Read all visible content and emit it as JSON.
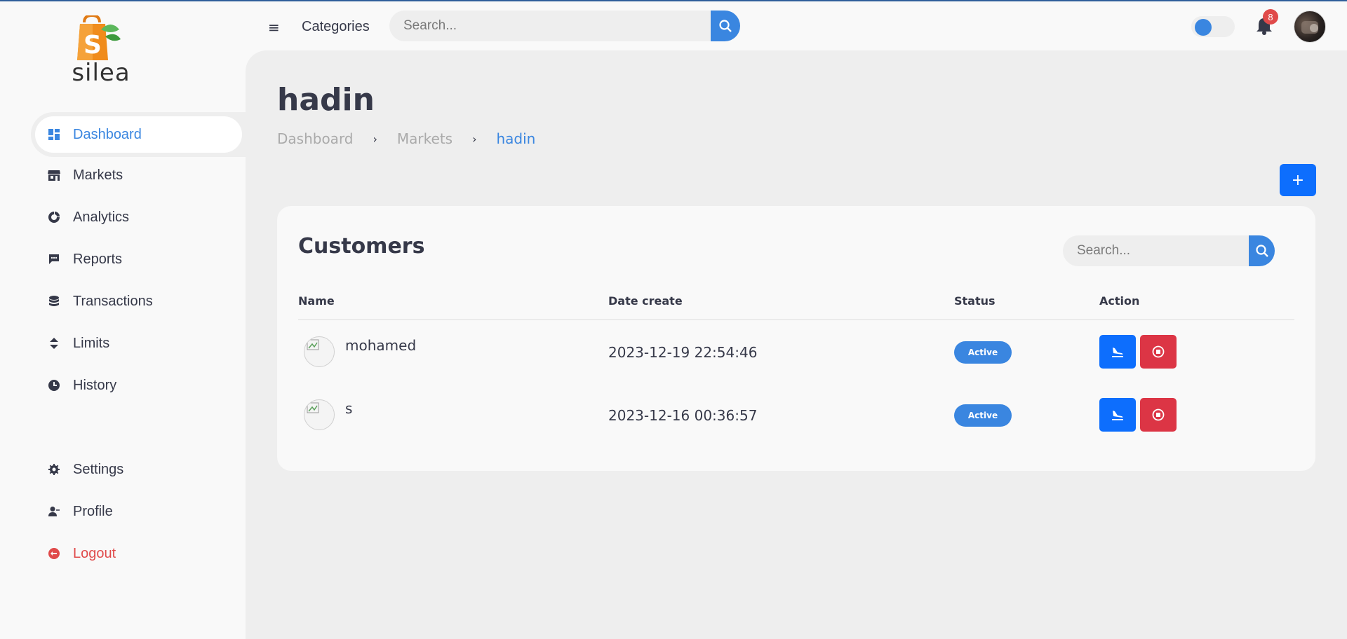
{
  "brand": {
    "name": "silea",
    "logo_letter": "S"
  },
  "sidebar": {
    "items": [
      {
        "label": "Dashboard",
        "icon": "dashboard-icon",
        "active": true
      },
      {
        "label": "Markets",
        "icon": "store-icon"
      },
      {
        "label": "Analytics",
        "icon": "analytics-icon"
      },
      {
        "label": "Reports",
        "icon": "reports-icon"
      },
      {
        "label": "Transactions",
        "icon": "database-icon"
      },
      {
        "label": "Limits",
        "icon": "sort-icon"
      },
      {
        "label": "History",
        "icon": "clock-icon"
      }
    ],
    "bottom_items": [
      {
        "label": "Settings",
        "icon": "gear-icon"
      },
      {
        "label": "Profile",
        "icon": "user-icon"
      },
      {
        "label": "Logout",
        "icon": "logout-icon"
      }
    ]
  },
  "header": {
    "menu_icon": "≡",
    "categories_label": "Categories",
    "search_placeholder": "Search...",
    "notification_count": "8"
  },
  "page": {
    "title": "hadin",
    "breadcrumb": [
      "Dashboard",
      "Markets",
      "hadin"
    ],
    "add_label": "+"
  },
  "customers": {
    "title": "Customers",
    "search_placeholder": "Search...",
    "columns": [
      "Name",
      "Date create",
      "Status",
      "Action"
    ],
    "rows": [
      {
        "name": "mohamed",
        "date": "2023-12-19 22:54:46",
        "status": "Active"
      },
      {
        "name": "s",
        "date": "2023-12-16 00:36:57",
        "status": "Active"
      }
    ]
  },
  "colors": {
    "accent": "#3a86e0",
    "primary_button": "#0d6efd",
    "danger_button": "#dc3545",
    "logout": "#e04a4a"
  }
}
